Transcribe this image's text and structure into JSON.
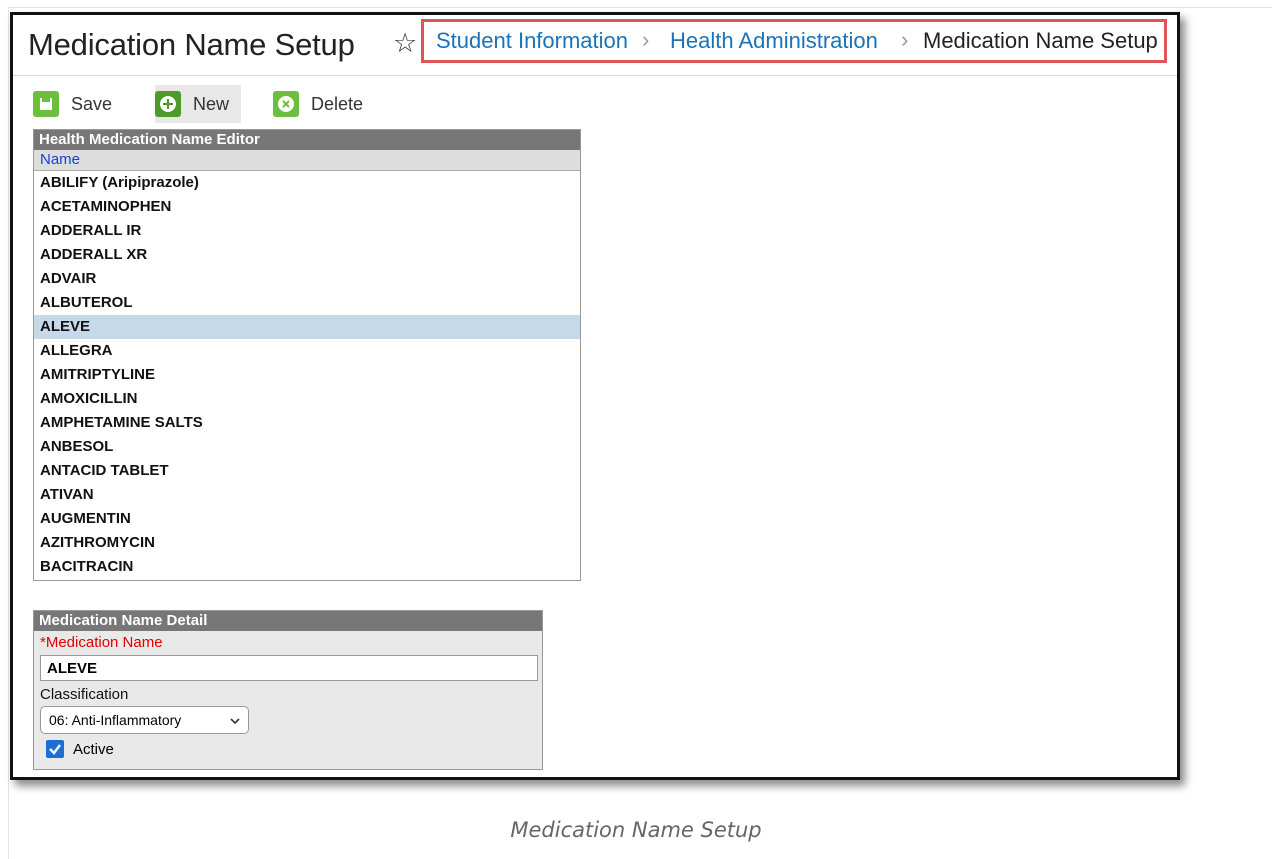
{
  "header": {
    "title": "Medication Name Setup",
    "breadcrumb": [
      "Student Information",
      "Health Administration",
      "Medication Name Setup"
    ]
  },
  "toolbar": {
    "save_label": "Save",
    "new_label": "New",
    "delete_label": "Delete"
  },
  "editor": {
    "title": "Health Medication Name Editor",
    "column": "Name",
    "rows": [
      "ABILIFY (Aripiprazole)",
      "ACETAMINOPHEN",
      "ADDERALL IR",
      "ADDERALL XR",
      "ADVAIR",
      "ALBUTEROL",
      "ALEVE",
      "ALLEGRA",
      "AMITRIPTYLINE",
      "AMOXICILLIN",
      "AMPHETAMINE SALTS",
      "ANBESOL",
      "ANTACID TABLET",
      "ATIVAN",
      "AUGMENTIN",
      "AZITHROMYCIN",
      "BACITRACIN"
    ],
    "selected": "ALEVE"
  },
  "detail": {
    "title": "Medication Name Detail",
    "name_label": "*Medication Name",
    "name_value": "ALEVE",
    "classification_label": "Classification",
    "classification_value": "06: Anti-Inflammatory",
    "active_label": "Active",
    "active": true
  },
  "caption": "Medication Name Setup",
  "colors": {
    "link": "#1a73b8",
    "highlight": "#e35353",
    "toolbar_icon": "#6dbe3c",
    "selected_row": "#c5d9ea"
  }
}
